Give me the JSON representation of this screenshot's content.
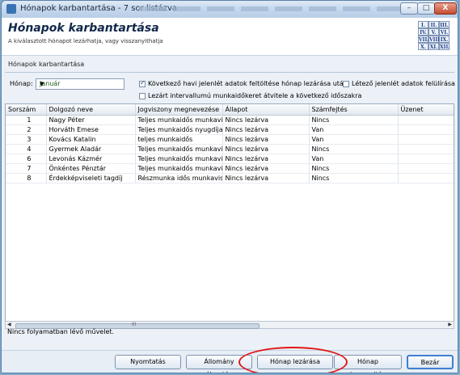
{
  "window": {
    "title": "Hónapok karbantartása - 7 sor listázva",
    "controls": {
      "minimize": "–",
      "maximize": "□",
      "close": "X"
    }
  },
  "header": {
    "title": "Hónapok karbantartása",
    "subtitle": "A kiválasztott hónapot lezárhatja, vagy visszanyithatja",
    "calendar_icon_labels": [
      "I.",
      "II.",
      "III.",
      "IV.",
      "V.",
      "VI.",
      "VII.",
      "VIII.",
      "IX.",
      "X.",
      "XI.",
      "XII."
    ]
  },
  "section_label": "Hónapok karbantartása",
  "filters": {
    "month_label": "Hónap:",
    "month_value": "Január",
    "cb_carry_over": {
      "label": "Következő havi jelenlét adatok feltöltése hónap lezárása után",
      "checked": true
    },
    "cb_override": {
      "label": "Létező jelenlét adatok felülírása",
      "checked": false
    },
    "cb_interval": {
      "label": "Lezárt intervallumú munkaidőkeret átvitele a következő időszakra",
      "checked": false
    }
  },
  "table": {
    "columns": [
      "Sorszám",
      "Dolgozó neve",
      "Jogviszony megnevezése",
      "Állapot",
      "Számfejtés",
      "Üzenet"
    ],
    "rows": [
      [
        "1",
        "Nagy Péter",
        "Teljes munkaidős munkaviszon",
        "Nincs lezárva",
        "Nincs",
        ""
      ],
      [
        "2",
        "Horváth Emese",
        "Teljes munkaidős nyugdíjas",
        "Nincs lezárva",
        "Van",
        ""
      ],
      [
        "3",
        "Kovács Katalin",
        "teljes munkaidős",
        "Nincs lezárva",
        "Van",
        ""
      ],
      [
        "4",
        "Gyermek Aladár",
        "Teljes munkaidős munkaviszon",
        "Nincs lezárva",
        "Nincs",
        ""
      ],
      [
        "6",
        "Levonás Kázmér",
        "Teljes munkaidős munkaviszon",
        "Nincs lezárva",
        "Van",
        ""
      ],
      [
        "7",
        "Önkéntes Pénztár",
        "Teljes munkaidős munkaviszon",
        "Nincs lezárva",
        "Nincs",
        ""
      ],
      [
        "8",
        "Érdekképviseleti tagdíj",
        "Részmunka idős munkaviszony",
        "Nincs lezárva",
        "Nincs",
        ""
      ]
    ]
  },
  "scrollbar": {
    "label": "III"
  },
  "status_text": "Nincs folyamatban lévő művelet.",
  "buttons": {
    "print": "Nyomtatás",
    "select_file": "Állomány választása",
    "close_month": "Hónap lezárása",
    "reopen_month": "Hónap visszanyitása",
    "close": "Bezár"
  },
  "colors": {
    "highlight_oval": "#e01717",
    "title_bar": "#c4d7ec"
  }
}
